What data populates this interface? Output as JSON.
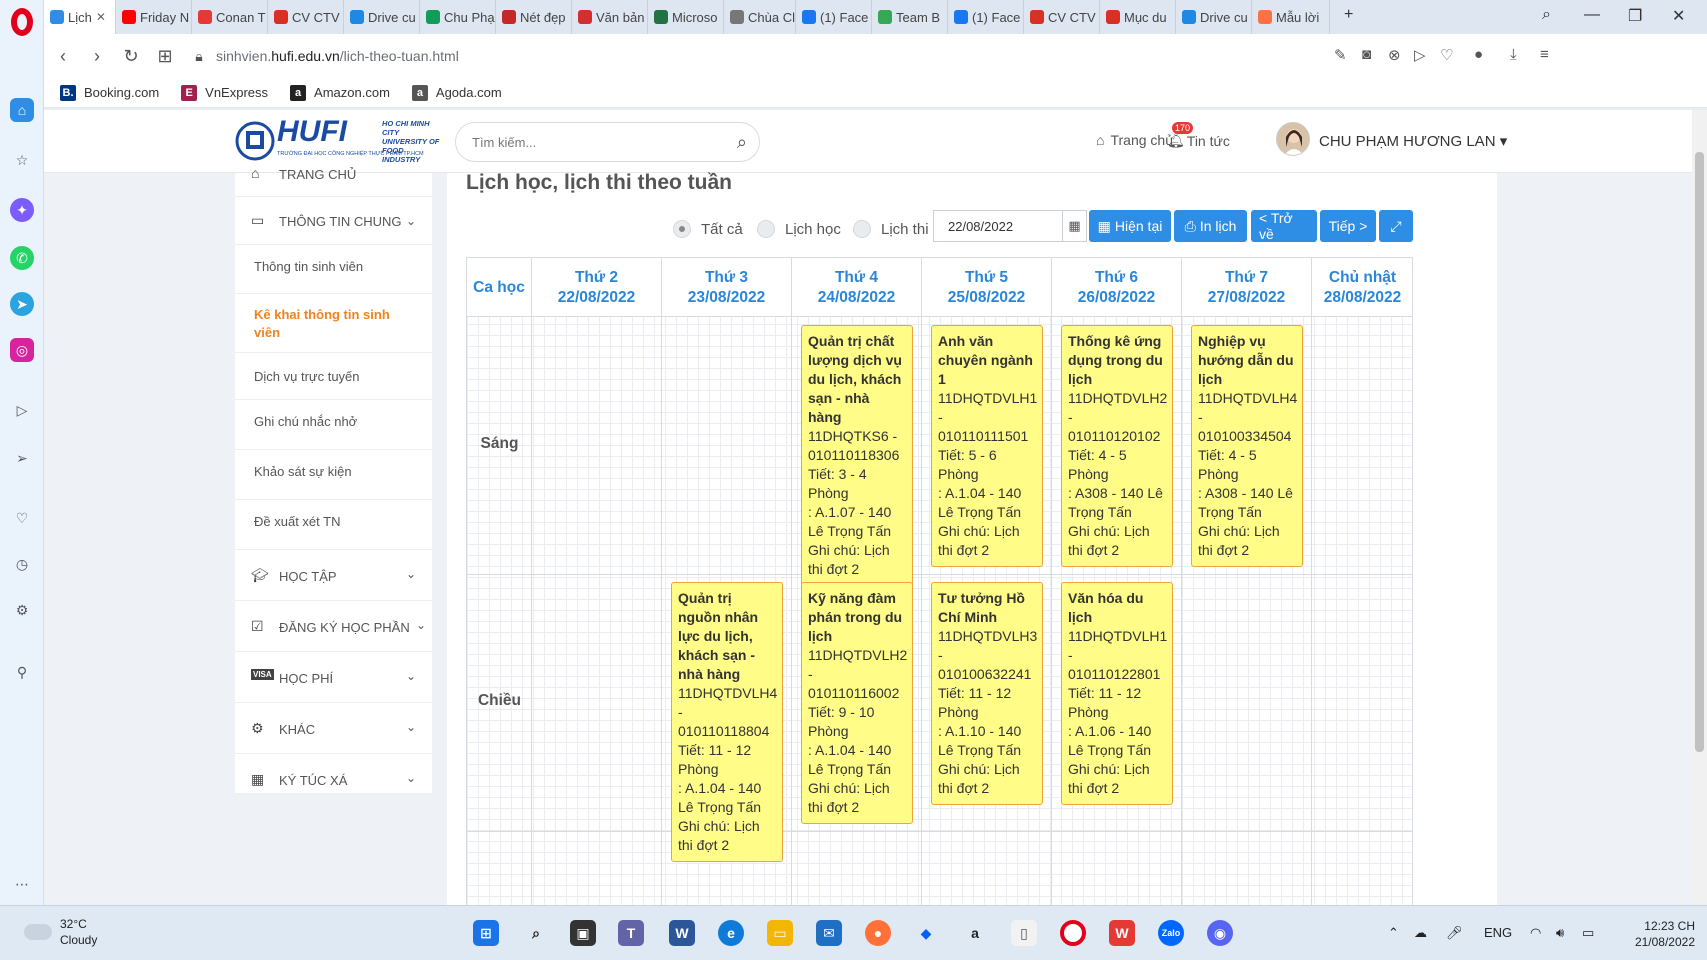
{
  "browser": {
    "tabs": [
      {
        "label": "Lịch",
        "color": "#2e8de4",
        "active": true
      },
      {
        "label": "Friday N",
        "color": "#ff0000"
      },
      {
        "label": "Conan T",
        "color": "#e53935"
      },
      {
        "label": "CV CTV",
        "color": "#d93025"
      },
      {
        "label": "Drive cu",
        "color": "#1e88e5"
      },
      {
        "label": "Chu Phạ",
        "color": "#0f9d58"
      },
      {
        "label": "Nét đẹp",
        "color": "#c62828"
      },
      {
        "label": "Văn bản",
        "color": "#d32f2f"
      },
      {
        "label": "Microso",
        "color": "#217346"
      },
      {
        "label": "Chùa Cl",
        "color": "#777777"
      },
      {
        "label": "(1) Face",
        "color": "#1877f2"
      },
      {
        "label": "Team B",
        "color": "#34a853"
      },
      {
        "label": "(1) Face",
        "color": "#1877f2"
      },
      {
        "label": "CV CTV",
        "color": "#d93025"
      },
      {
        "label": "Mục du",
        "color": "#d93025"
      },
      {
        "label": "Drive cu",
        "color": "#1e88e5"
      },
      {
        "label": "Mẫu lời",
        "color": "#ff7043"
      }
    ],
    "url_prefix": "sinhvien.",
    "url_domain": "hufi.edu.vn",
    "url_path": "/lich-theo-tuan.html",
    "bookmarks": [
      {
        "label": "Booking.com",
        "icon_text": "B.",
        "color": "#003580"
      },
      {
        "label": "VnExpress",
        "icon_text": "E",
        "color": "#9f224e"
      },
      {
        "label": "Amazon.com",
        "icon_text": "a",
        "color": "#222222"
      },
      {
        "label": "Agoda.com",
        "icon_text": "a",
        "color": "#555555"
      }
    ]
  },
  "header": {
    "logo_text": "HUFI",
    "logo_sub1": "HO CHI MINH CITY",
    "logo_sub2": "UNIVERSITY OF",
    "logo_sub3": "FOOD INDUSTRY",
    "logo_sub4": "TRƯỜNG ĐẠI HỌC CÔNG NGHIỆP THỰC PHẨM TP.HCM",
    "search_placeholder": "Tìm kiếm...",
    "home_label": "Trang chủ",
    "news_label": "Tin tức",
    "news_badge": "170",
    "user_name": "CHU PHẠM HƯƠNG LAN"
  },
  "menu": {
    "home": "TRANG CHỦ",
    "general": "THÔNG TIN CHUNG",
    "sub_items": [
      "Thông tin sinh viên",
      "Kê khai thông tin sinh viên",
      "Dịch vụ trực tuyến",
      "Ghi chú nhắc nhở",
      "Khảo sát sự kiện",
      "Đề xuất xét TN"
    ],
    "study": "HỌC TẬP",
    "register": "ĐĂNG KÝ HỌC PHẦN",
    "fees": "HỌC PHÍ",
    "fees_icon_text": "VISA",
    "other": "KHÁC",
    "dorm": "KÝ TÚC XÁ"
  },
  "main": {
    "title": "Lịch học, lịch thi theo tuần",
    "filters": [
      "Tất cả",
      "Lịch học",
      "Lịch thi"
    ],
    "selected_filter": "Tất cả",
    "date_value": "22/08/2022",
    "buttons": {
      "current": "Hiện tại",
      "print": "In lịch",
      "back": "< Trở về",
      "next": "Tiếp >"
    }
  },
  "schedule": {
    "session_header": "Ca học",
    "days": [
      {
        "name": "Thứ 2",
        "date": "22/08/2022"
      },
      {
        "name": "Thứ 3",
        "date": "23/08/2022"
      },
      {
        "name": "Thứ 4",
        "date": "24/08/2022"
      },
      {
        "name": "Thứ 5",
        "date": "25/08/2022"
      },
      {
        "name": "Thứ 6",
        "date": "26/08/2022"
      },
      {
        "name": "Thứ 7",
        "date": "27/08/2022"
      },
      {
        "name": "Chủ nhật",
        "date": "28/08/2022"
      }
    ],
    "sessions": [
      "Sáng",
      "Chiều"
    ],
    "label_period": "Tiết: ",
    "label_room": "Phòng",
    "label_note": "Ghi chú: ",
    "classes": [
      {
        "session": 0,
        "day": 2,
        "name": "Quản trị chất lượng dịch vụ du lịch, khách sạn - nhà hàng",
        "code": "11DHQTKS6 - 010110118306",
        "period": "3 - 4",
        "room": ": A.1.07 - 140 Lê Trọng Tấn",
        "note": "Lịch thi đợt 2"
      },
      {
        "session": 0,
        "day": 3,
        "name": "Anh văn chuyên ngành 1",
        "code": "11DHQTDVLH1 - 010110111501",
        "period": "5 - 6",
        "room": ": A.1.04 - 140 Lê Trọng Tấn",
        "note": "Lịch thi đợt 2"
      },
      {
        "session": 0,
        "day": 4,
        "name": "Thống kê ứng dụng trong du lịch",
        "code": "11DHQTDVLH2 - 010110120102",
        "period": "4 - 5",
        "room": ": A308 - 140 Lê Trọng Tấn",
        "note": "Lịch thi đợt 2"
      },
      {
        "session": 0,
        "day": 5,
        "name": "Nghiệp vụ hướng dẫn du lịch",
        "code": "11DHQTDVLH4 - 010100334504",
        "period": "4 - 5",
        "room": ": A308 - 140 Lê Trọng Tấn",
        "note": "Lịch thi đợt 2"
      },
      {
        "session": 1,
        "day": 1,
        "name": "Quản trị nguồn nhân lực du lịch, khách sạn - nhà hàng",
        "code": "11DHQTDVLH4 - 010110118804",
        "period": "11 - 12",
        "room": ": A.1.04 - 140 Lê Trọng Tấn",
        "note": "Lịch thi đợt 2"
      },
      {
        "session": 1,
        "day": 2,
        "name": "Kỹ năng đàm phán trong du lịch",
        "code": "11DHQTDVLH2 - 010110116002",
        "period": "9 - 10",
        "room": ": A.1.04 - 140 Lê Trọng Tấn",
        "note": "Lịch thi đợt 2"
      },
      {
        "session": 1,
        "day": 3,
        "name": "Tư tưởng Hồ Chí Minh",
        "code": "11DHQTDVLH3 - 010100632241",
        "period": "11 - 12",
        "room": ": A.1.10 - 140 Lê Trọng Tấn",
        "note": "Lịch thi đợt 2"
      },
      {
        "session": 1,
        "day": 4,
        "name": "Văn hóa du lịch",
        "code": "11DHQTDVLH1 - 010110122801",
        "period": "11 - 12",
        "room": ": A.1.06 - 140 Lê Trọng Tấn",
        "note": "Lịch thi đợt 2"
      }
    ]
  },
  "taskbar": {
    "temp": "32°C",
    "weather": "Cloudy",
    "lang": "ENG",
    "time": "12:23 CH",
    "date": "21/08/2022"
  }
}
